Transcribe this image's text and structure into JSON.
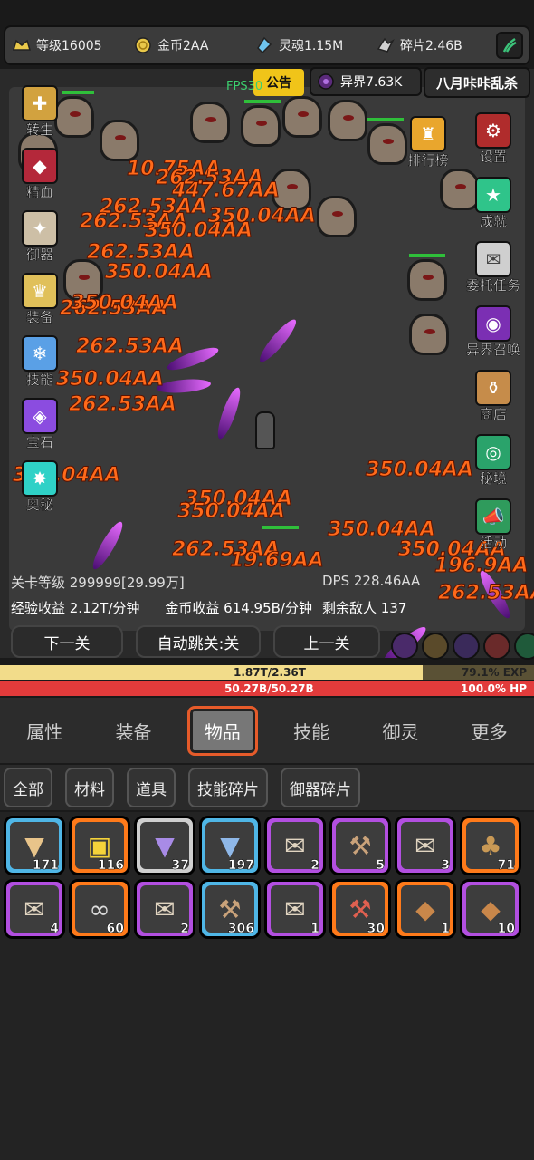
{
  "resources": [
    {
      "icon": "level-crown-icon",
      "label": "等级16005"
    },
    {
      "icon": "gold-coin-icon",
      "label": "金币2AA"
    },
    {
      "icon": "soul-gem-icon",
      "label": "灵魂1.15M"
    },
    {
      "icon": "fragment-icon",
      "label": "碎片2.46B"
    }
  ],
  "announce_label": "公告",
  "otherworld_label": "异界7.63K",
  "event_label": "八月咔咔乱杀",
  "fps_label": "FPS30",
  "left_menu": [
    {
      "label": "转生",
      "icon": "rebirth-icon",
      "color": "#d2a23f"
    },
    {
      "label": "精血",
      "icon": "blood-icon",
      "color": "#b4283a"
    },
    {
      "label": "御器",
      "icon": "artifact-icon",
      "color": "#cdbfa6"
    },
    {
      "label": "装备",
      "icon": "equipment-icon",
      "color": "#e0c05a"
    },
    {
      "label": "技能",
      "icon": "skill-icon",
      "color": "#5aa0e6"
    },
    {
      "label": "宝石",
      "icon": "gem-icon",
      "color": "#8b4ce0"
    },
    {
      "label": "奥秘",
      "icon": "arcane-icon",
      "color": "#2fd1c7"
    }
  ],
  "right_menu": [
    {
      "label": "排行榜",
      "icon": "trophy-icon",
      "color": "#e9a62d"
    },
    {
      "label": "设置",
      "icon": "settings-icon",
      "color": "#b02c2c"
    },
    {
      "label": "成就",
      "icon": "star-icon",
      "color": "#2fc48a"
    },
    {
      "label": "委托任务",
      "icon": "quest-icon",
      "color": "#cfcfcf"
    },
    {
      "label": "异界召唤",
      "icon": "summon-icon",
      "color": "#7b2fb3"
    },
    {
      "label": "商店",
      "icon": "shop-icon",
      "color": "#c68c4a"
    },
    {
      "label": "秘境",
      "icon": "portal-icon",
      "color": "#2aa36b"
    },
    {
      "label": "活动",
      "icon": "event-horn-icon",
      "color": "#2f9b5c"
    }
  ],
  "damage_numbers": [
    "10.75AA",
    "262.53AA",
    "447.67AA",
    "262.53AA",
    "350.04AA",
    "262.53AA",
    "350.04AA",
    "262.53AA",
    "350.04AA",
    "262.53AA",
    "350.04AA",
    "262.53AA",
    "350.04AA",
    "262.53AA",
    "350.04AA",
    "350.04AA",
    "350.04AA",
    "350.04AA",
    "262.53AA",
    "350.04AA",
    "196.9AA",
    "262.53AA",
    "19.69AA",
    "350.04AA"
  ],
  "stage_label": "关卡等级 299999[29.99万]",
  "dps_label": "DPS 228.46AA",
  "exp_income": "经验收益 2.12T/分钟",
  "gold_income": "金币收益 614.95B/分钟",
  "enemies_left": "剩余敌人 137",
  "buttons": {
    "next_stage": "下一关",
    "auto_jump": "自动跳关:关",
    "prev_stage": "上一关"
  },
  "exp_bar": {
    "text": "1.87T/2.36T",
    "percent_text": "79.1% EXP",
    "fill": 0.791,
    "color": "#f2dc8a"
  },
  "hp_bar": {
    "text": "50.27B/50.27B",
    "percent_text": "100.0% HP",
    "fill": 1.0,
    "color": "#e23b3b"
  },
  "tabs": [
    {
      "label": "属性",
      "active": false
    },
    {
      "label": "装备",
      "active": false
    },
    {
      "label": "物品",
      "active": true
    },
    {
      "label": "技能",
      "active": false
    },
    {
      "label": "御灵",
      "active": false
    },
    {
      "label": "更多",
      "active": false
    }
  ],
  "filters": [
    "全部",
    "材料",
    "道具",
    "技能碎片",
    "御器碎片"
  ],
  "items": [
    {
      "icon": "tie-icon",
      "count": "171",
      "border": "#4fb6e6",
      "glyph": "▼",
      "glyph_color": "#e8c48a"
    },
    {
      "icon": "treasure-chest-icon",
      "count": "116",
      "border": "#ff7a1a",
      "glyph": "▣",
      "glyph_color": "#f5d33a"
    },
    {
      "icon": "tie-icon",
      "count": "37",
      "border": "#cfcfcf",
      "glyph": "▼",
      "glyph_color": "#a88be6"
    },
    {
      "icon": "tie-icon",
      "count": "197",
      "border": "#4fb6e6",
      "glyph": "▼",
      "glyph_color": "#8fb8e8"
    },
    {
      "icon": "scroll-icon",
      "count": "2",
      "border": "#b24fe0",
      "glyph": "✉",
      "glyph_color": "#e0d4c0"
    },
    {
      "icon": "toolbox-icon",
      "count": "5",
      "border": "#b24fe0",
      "glyph": "⚒",
      "glyph_color": "#c9a27a"
    },
    {
      "icon": "scroll-icon",
      "count": "3",
      "border": "#b24fe0",
      "glyph": "✉",
      "glyph_color": "#e0d4c0"
    },
    {
      "icon": "seed-bag-icon",
      "count": "71",
      "border": "#ff7a1a",
      "glyph": "♣",
      "glyph_color": "#c99955"
    },
    {
      "icon": "scroll-icon",
      "count": "4",
      "border": "#b24fe0",
      "glyph": "✉",
      "glyph_color": "#e0d4c0"
    },
    {
      "icon": "book-icon",
      "count": "60",
      "border": "#ff7a1a",
      "glyph": "∞",
      "glyph_color": "#dcdcdc"
    },
    {
      "icon": "scroll-icon",
      "count": "2",
      "border": "#b24fe0",
      "glyph": "✉",
      "glyph_color": "#e0d4c0"
    },
    {
      "icon": "toolbox-icon",
      "count": "306",
      "border": "#4fb6e6",
      "glyph": "⚒",
      "glyph_color": "#c9a27a"
    },
    {
      "icon": "scroll-icon",
      "count": "1",
      "border": "#b24fe0",
      "glyph": "✉",
      "glyph_color": "#e0d4c0"
    },
    {
      "icon": "toolbox-icon",
      "count": "30",
      "border": "#ff7a1a",
      "glyph": "⚒",
      "glyph_color": "#e06050"
    },
    {
      "icon": "wooden-crate-icon",
      "count": "1",
      "border": "#ff7a1a",
      "glyph": "◆",
      "glyph_color": "#c9874a"
    },
    {
      "icon": "wooden-crate-icon",
      "count": "10",
      "border": "#b24fe0",
      "glyph": "◆",
      "glyph_color": "#c9874a"
    }
  ]
}
